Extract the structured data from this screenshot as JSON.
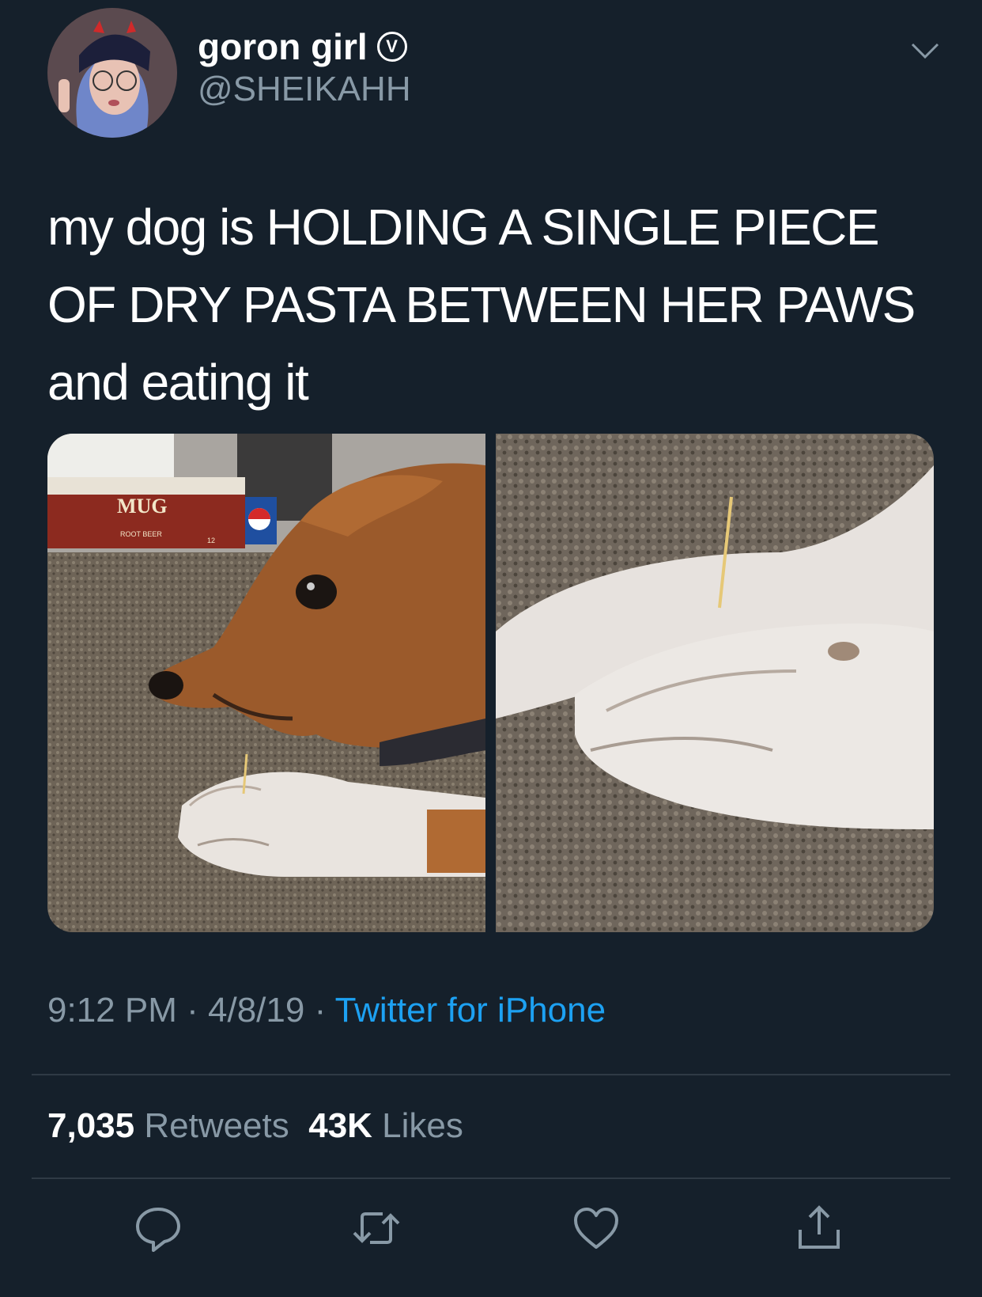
{
  "tweet": {
    "display_name": "goron girl",
    "verified_mark": "V",
    "handle": "@SHEIKAHH",
    "text_lines": [
      "my dog is HOLDING A SINGLE PIECE",
      "OF DRY PASTA BETWEEN HER PAWS",
      "and eating it"
    ],
    "time": "9:12 PM",
    "separator": "·",
    "date": "4/8/19",
    "source": "Twitter for iPhone",
    "retweets_count": "7,035",
    "retweets_label": "Retweets",
    "likes_count": "43K",
    "likes_label": "Likes",
    "photo_text": {
      "box_brand": "MUG",
      "box_flavor": "ROOT BEER",
      "box_count": "12"
    }
  },
  "icons": {
    "more": "chevron-down-icon",
    "reply": "reply-icon",
    "retweet": "retweet-icon",
    "like": "heart-icon",
    "share": "share-icon"
  },
  "colors": {
    "background": "#15202b",
    "secondary_text": "#8899a6",
    "link": "#1da1f2",
    "divider": "#2f3a45"
  }
}
